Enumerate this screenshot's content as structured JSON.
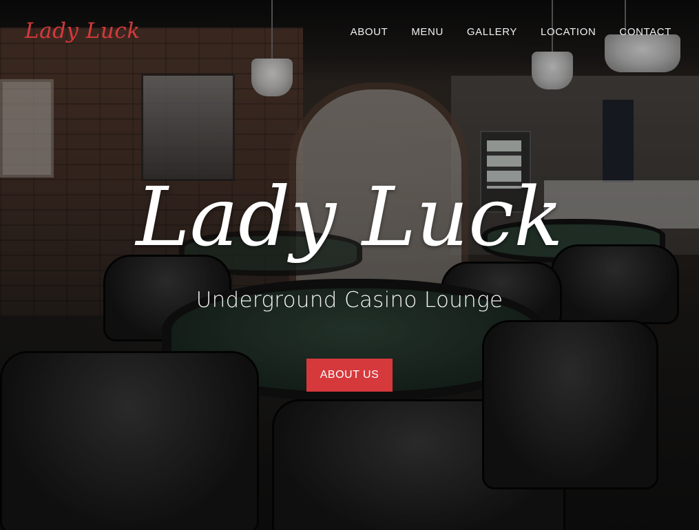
{
  "brand": {
    "logo_text": "Lady Luck",
    "accent_color": "#d6393c"
  },
  "nav": {
    "items": [
      {
        "label": "ABOUT"
      },
      {
        "label": "MENU"
      },
      {
        "label": "GALLERY"
      },
      {
        "label": "LOCATION"
      },
      {
        "label": "CONTACT"
      }
    ]
  },
  "hero": {
    "title": "Lady Luck",
    "subtitle": "Underground Casino Lounge",
    "cta_label": "ABOUT US"
  }
}
